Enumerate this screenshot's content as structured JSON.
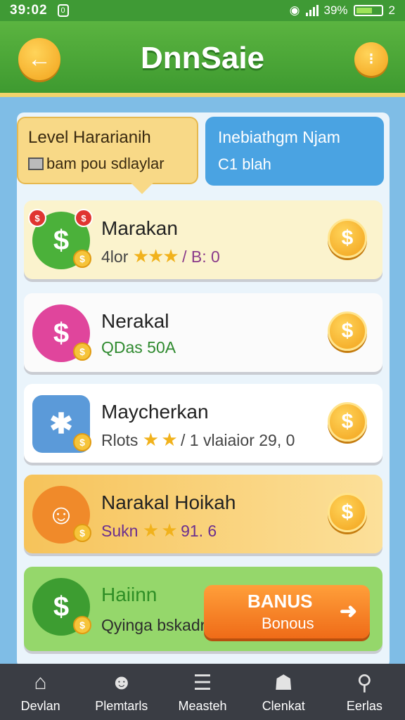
{
  "status_bar": {
    "time": "39:02",
    "notification": "0",
    "battery": "39%",
    "extra": "2"
  },
  "header": {
    "title": "DnnSaie",
    "back_icon": "arrow-left-icon",
    "menu_icon": "dots-icon"
  },
  "tabs": {
    "level": {
      "title": "Level Hararianih",
      "subtitle": "bam pou sdlaylar"
    },
    "other": {
      "title": "Inebiathgm Njam",
      "subtitle": "C1 blah"
    }
  },
  "rows": [
    {
      "title": "Marakan",
      "sub_prefix": "4lor",
      "stars": "★★★",
      "sub_suffix": "/ B: 0",
      "icon": "chat-dollar-icon"
    },
    {
      "title": "Nerakal",
      "sub_prefix": "QDas 50A",
      "stars": "",
      "sub_suffix": "",
      "icon": "dollar-bubble-icon"
    },
    {
      "title": "Maycherkan",
      "sub_prefix": "Rlots",
      "stars": "★ ★",
      "sub_suffix": "/ 1 vlaiaior 29, 0",
      "icon": "clock-calc-icon"
    },
    {
      "title": "Narakal Hoikah",
      "sub_prefix": "Sukn",
      "stars": "★ ★",
      "sub_suffix": "91. 6",
      "icon": "lion-gear-icon"
    },
    {
      "title": "Haiinn",
      "sub_prefix": "Qyinga bskadratanh",
      "stars": "",
      "sub_suffix": "",
      "icon": "money-bag-icon"
    }
  ],
  "bonus": {
    "label": "BANUS",
    "sub": "Bonous",
    "arrow": "➜"
  },
  "nav": [
    {
      "label": "Devlan",
      "icon": "home-icon"
    },
    {
      "label": "Plemtarls",
      "icon": "people-chat-icon"
    },
    {
      "label": "Measteh",
      "icon": "list-icon"
    },
    {
      "label": "Clenkat",
      "icon": "person-settings-icon"
    },
    {
      "label": "Eerlas",
      "icon": "search-icon"
    }
  ],
  "colors": {
    "accent_green": "#3e9a30",
    "gold": "#f2a21b",
    "blue": "#4aa3e2",
    "orange": "#ef6b18"
  }
}
